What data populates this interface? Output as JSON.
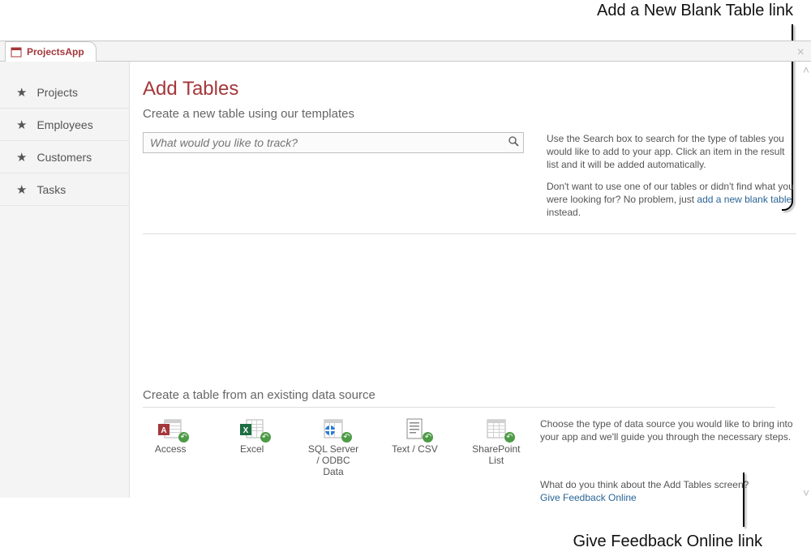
{
  "annotations": {
    "top": "Add a New Blank Table link",
    "bottom": "Give Feedback Online link"
  },
  "tab": {
    "title": "ProjectsApp"
  },
  "sidebar": {
    "items": [
      {
        "label": "Projects"
      },
      {
        "label": "Employees"
      },
      {
        "label": "Customers"
      },
      {
        "label": "Tasks"
      }
    ]
  },
  "main": {
    "title": "Add Tables",
    "subtitle": "Create a new table using our templates",
    "search_placeholder": "What would you like to track?",
    "help1": "Use the Search box to search for the type of tables you would like to add to your app. Click an item in the result list and it will be added automatically.",
    "help2_a": "Don't want to use one of our tables or didn't find what you were looking for? No problem, just ",
    "help2_link": "add a new blank table",
    "help2_b": " instead.",
    "existing_heading": "Create a table from an existing data source",
    "sources": [
      {
        "label": "Access"
      },
      {
        "label": "Excel"
      },
      {
        "label": "SQL Server / ODBC Data"
      },
      {
        "label": "Text / CSV"
      },
      {
        "label": "SharePoint List"
      }
    ],
    "sources_help": "Choose the type of data source you would like to bring into your app and we'll guide you through the necessary steps.",
    "feedback_a": "What do you think about the Add Tables screen? ",
    "feedback_link": "Give Feedback Online"
  }
}
